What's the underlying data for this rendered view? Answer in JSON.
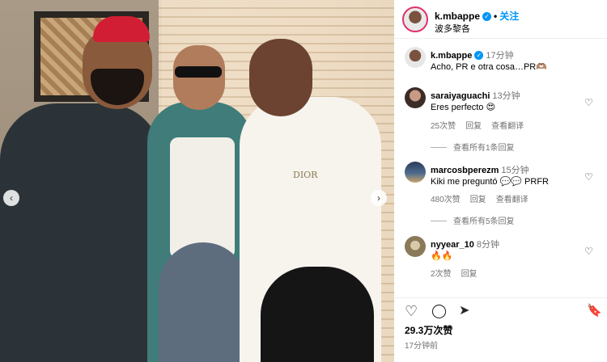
{
  "photo": {
    "shirt_text": "DIOR",
    "nav_prev": "‹",
    "nav_next": "›"
  },
  "header": {
    "username": "k.mbappe",
    "verified_mark": "✓",
    "separator": "•",
    "follow_label": "关注",
    "location": "波多黎各"
  },
  "caption": {
    "username": "k.mbappe",
    "verified_mark": "✓",
    "time": "17分钟",
    "text": "Acho, PR e otra cosa…PR🫶🏽"
  },
  "comments": [
    {
      "username": "saraiyaguachi",
      "time": "13分钟",
      "text": "Eres perfecto 😍",
      "likes": "25次赞",
      "reply": "回复",
      "translate": "查看翻译",
      "replies_label": "查看所有1条回复"
    },
    {
      "username": "marcosbperezm",
      "time": "15分钟",
      "text": "Kiki me preguntó 💬💬 PRFR",
      "likes": "480次赞",
      "reply": "回复",
      "translate": "查看翻译",
      "replies_label": "查看所有5条回复"
    },
    {
      "username": "nyyear_10",
      "time": "8分钟",
      "text": "🔥🔥",
      "likes": "2次赞",
      "reply": "回复"
    }
  ],
  "icons": {
    "like": "heart-icon",
    "comment": "comment-icon",
    "share": "share-icon",
    "save": "bookmark-icon",
    "comment_like": "heart-icon"
  },
  "glyphs": {
    "like": "♡",
    "comment": "◯",
    "share": "➤",
    "save": "🔖",
    "comment_like": "♡"
  },
  "footer": {
    "likes": "29.3万次赞",
    "time": "17分钟前"
  },
  "colors": {
    "accent": "#0095f6",
    "story_ring": "#e1306c",
    "secondary_text": "#737373"
  }
}
